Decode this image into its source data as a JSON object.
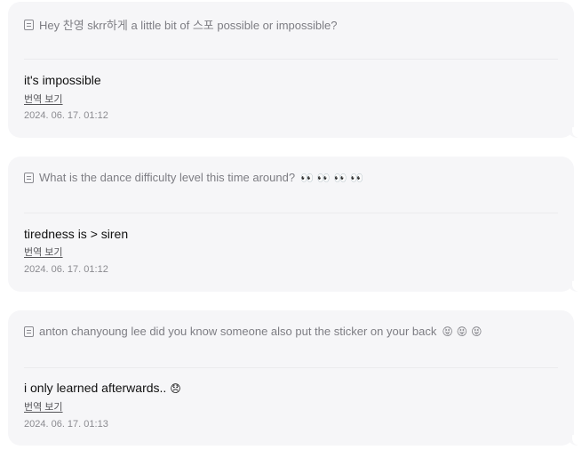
{
  "posts": [
    {
      "question": "Hey 찬영 skrr하게 a little bit of 스포 possible or impossible?",
      "question_emoji": "",
      "answer": "it's impossible",
      "answer_emoji": "",
      "translate_label": "번역 보기",
      "timestamp": "2024. 06. 17. 01:12"
    },
    {
      "question": "What is the dance difficulty level this time around?",
      "question_emoji": "👀 👀 👀 👀",
      "answer": "tiredness is > siren",
      "answer_emoji": "",
      "translate_label": "번역 보기",
      "timestamp": "2024. 06. 17. 01:12"
    },
    {
      "question": "anton chanyoung lee did you know someone also put the sticker on your back",
      "question_emoji": "😝 😝 😝",
      "answer": "i only learned afterwards..",
      "answer_emoji": "😞",
      "translate_label": "번역 보기",
      "timestamp": "2024. 06. 17. 01:13"
    }
  ],
  "icons": {
    "question": "note-icon"
  }
}
